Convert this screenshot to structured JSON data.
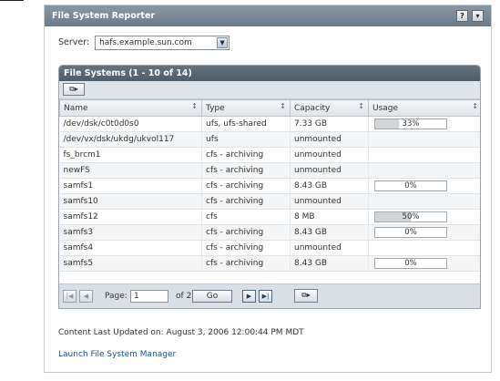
{
  "portlet": {
    "title": "File System Reporter",
    "help_icon": "?",
    "menu_icon": "▾"
  },
  "server": {
    "label": "Server:",
    "value": "hafs.example.sun.com"
  },
  "table": {
    "title": "File Systems (1 - 10 of 14)",
    "columns": [
      "Name",
      "Type",
      "Capacity",
      "Usage"
    ],
    "rows": [
      {
        "name": "/dev/dsk/c0t0d0s0",
        "type": "ufs, ufs-shared",
        "capacity": "7.33 GB",
        "usage": "33%",
        "usage_pct": 33
      },
      {
        "name": "/dev/vx/dsk/ukdg/ukvol117",
        "type": "ufs",
        "capacity": "unmounted",
        "usage": "",
        "usage_pct": null
      },
      {
        "name": "fs_brcm1",
        "type": "cfs - archiving",
        "capacity": "unmounted",
        "usage": "",
        "usage_pct": null
      },
      {
        "name": "newFS",
        "type": "cfs - archiving",
        "capacity": "unmounted",
        "usage": "",
        "usage_pct": null
      },
      {
        "name": "samfs1",
        "type": "cfs - archiving",
        "capacity": "8.43 GB",
        "usage": "0%",
        "usage_pct": 0
      },
      {
        "name": "samfs10",
        "type": "cfs - archiving",
        "capacity": "unmounted",
        "usage": "",
        "usage_pct": null
      },
      {
        "name": "samfs12",
        "type": "cfs",
        "capacity": "8 MB",
        "usage": "50%",
        "usage_pct": 50
      },
      {
        "name": "samfs3",
        "type": "cfs - archiving",
        "capacity": "8.43 GB",
        "usage": "0%",
        "usage_pct": 0
      },
      {
        "name": "samfs4",
        "type": "cfs - archiving",
        "capacity": "unmounted",
        "usage": "",
        "usage_pct": null
      },
      {
        "name": "samfs5",
        "type": "cfs - archiving",
        "capacity": "8.43 GB",
        "usage": "0%",
        "usage_pct": 0
      }
    ]
  },
  "pager": {
    "page_label": "Page:",
    "page_value": "1",
    "of_label": "of 2",
    "go_label": "Go"
  },
  "footer": {
    "updated": "Content Last Updated on: August 3, 2006 12:00:44 PM MDT",
    "launch": "Launch File System Manager"
  },
  "colors": {
    "header": "#6c7b89",
    "table_title": "#4e5d69",
    "usage_fill": "#d3d6d9",
    "link": "#1d4f8c"
  }
}
